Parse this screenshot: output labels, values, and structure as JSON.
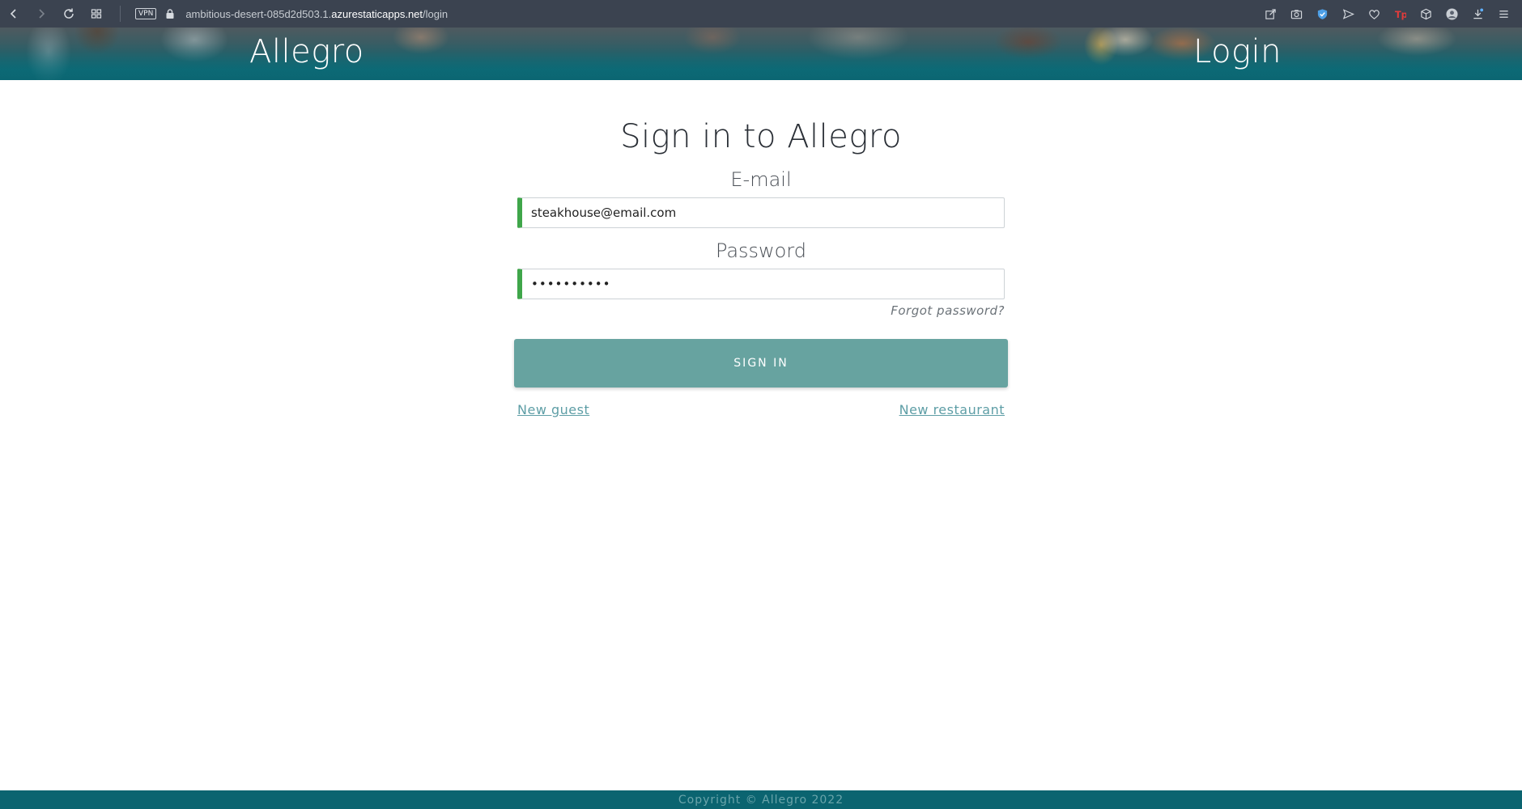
{
  "browser": {
    "vpn_label": "VPN",
    "url_prefix": "ambitious-desert-085d2d503.1.",
    "url_host": "azurestaticapps.net",
    "url_path": "/login"
  },
  "header": {
    "brand": "Allegro",
    "page_title": "Login"
  },
  "form": {
    "title": "Sign in to Allegro",
    "email_label": "E-mail",
    "email_value": "steakhouse@email.com",
    "password_label": "Password",
    "password_value": "••••••••••",
    "forgot_link": "Forgot password?",
    "submit_label": "SIGN IN",
    "new_guest_link": "New guest",
    "new_restaurant_link": "New restaurant"
  },
  "footer": {
    "copyright": "Copyright © Allegro 2022"
  },
  "colors": {
    "header_teal": "#0b6672",
    "valid_border": "#3fa64a",
    "button": "#67a3a0",
    "link": "#5e9ea6",
    "footer": "#0b6470"
  },
  "icons": {
    "browser_left": [
      "back-arrow-icon",
      "forward-arrow-icon",
      "reload-icon",
      "tabs-grid-icon"
    ],
    "browser_right": [
      "share-icon",
      "camera-icon",
      "shield-icon",
      "send-icon",
      "heart-icon",
      "tp-extension-icon",
      "cube-icon",
      "profile-icon",
      "download-icon",
      "menu-icon"
    ]
  }
}
